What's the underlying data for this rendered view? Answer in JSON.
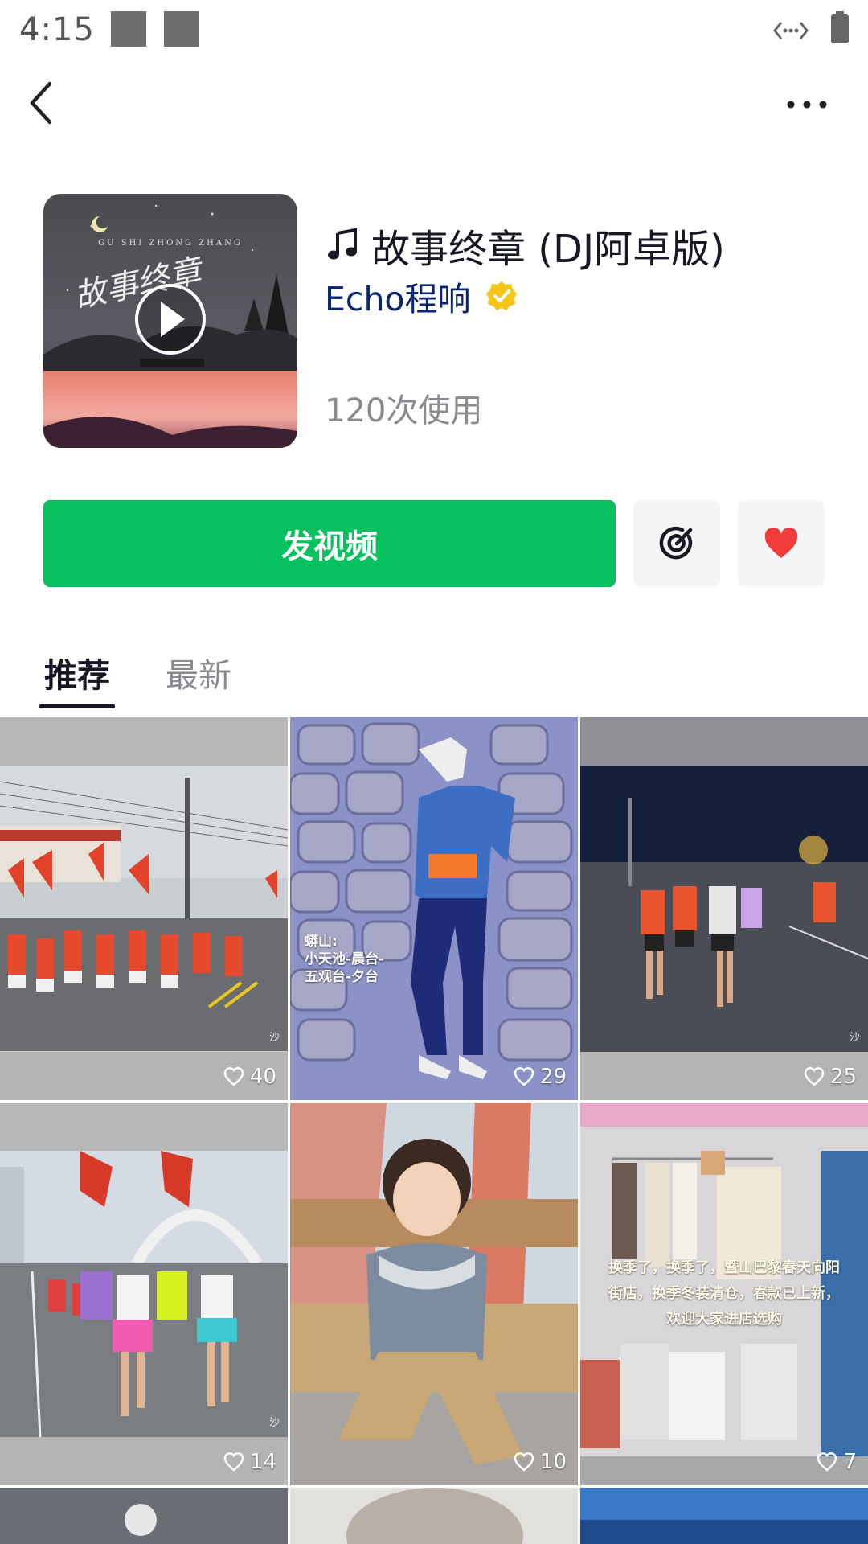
{
  "status_bar": {
    "time": "4:15"
  },
  "song": {
    "title": "故事终章 (DJ阿卓版)",
    "artist": "Echo程响",
    "usage": "120次使用",
    "cover_text": "GU SHI ZHONG ZHANG",
    "cover_calligraphy": "故事终章"
  },
  "actions": {
    "post_label": "发视频"
  },
  "tabs": [
    {
      "label": "推荐",
      "active": true
    },
    {
      "label": "最新",
      "active": false
    }
  ],
  "videos": [
    {
      "likes": "40",
      "overlay": "",
      "watermark": "沙"
    },
    {
      "likes": "29",
      "overlay": "蟒山:\n小天池-晨台-\n五观台-夕台",
      "watermark": ""
    },
    {
      "likes": "25",
      "overlay": "",
      "watermark": "沙"
    },
    {
      "likes": "14",
      "overlay": "",
      "watermark": "沙"
    },
    {
      "likes": "10",
      "overlay": "",
      "watermark": ""
    },
    {
      "likes": "7",
      "overlay": "换季了，换季了，暨山巴黎春天向阳\n街店，换季冬装清仓，春款已上新，\n欢迎大家进店选购",
      "watermark": ""
    }
  ],
  "colors": {
    "accent_green": "#08c15e",
    "heart_red": "#f23c3c",
    "artist_blue": "#0a2372",
    "verified_gold": "#f5c518"
  },
  "icons": {
    "back": "chevron-left-icon",
    "more": "more-dots-icon",
    "note": "music-note-icon",
    "verified": "verified-badge-icon",
    "record": "record-icon",
    "favorite": "heart-icon",
    "like": "heart-outline-icon",
    "play": "play-icon"
  }
}
